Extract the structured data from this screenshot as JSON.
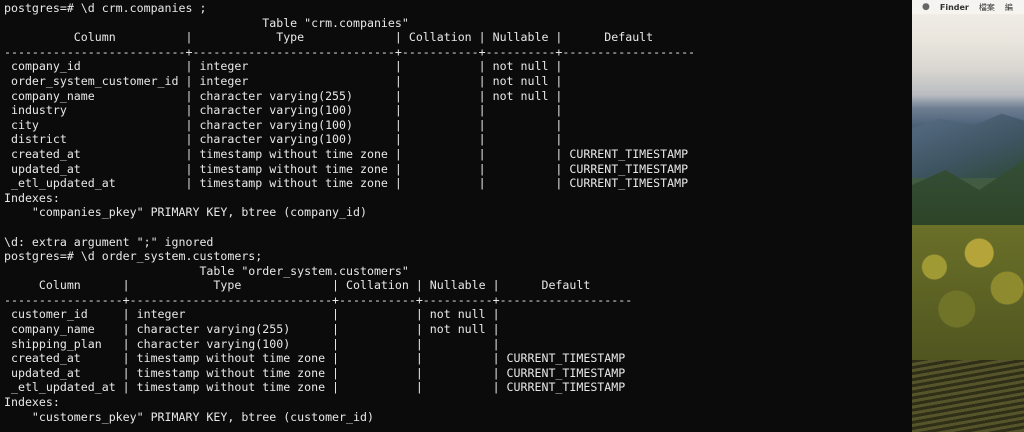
{
  "terminal": {
    "lines": [
      "postgres=# \\d crm.companies ;",
      "                                     Table \"crm.companies\"",
      "          Column          |            Type             | Collation | Nullable |      Default",
      "--------------------------+-----------------------------+-----------+----------+-------------------",
      " company_id               | integer                     |           | not null |",
      " order_system_customer_id | integer                     |           | not null |",
      " company_name             | character varying(255)      |           | not null |",
      " industry                 | character varying(100)      |           |          |",
      " city                     | character varying(100)      |           |          |",
      " district                 | character varying(100)      |           |          |",
      " created_at               | timestamp without time zone |           |          | CURRENT_TIMESTAMP",
      " updated_at               | timestamp without time zone |           |          | CURRENT_TIMESTAMP",
      " _etl_updated_at          | timestamp without time zone |           |          | CURRENT_TIMESTAMP",
      "Indexes:",
      "    \"companies_pkey\" PRIMARY KEY, btree (company_id)",
      "",
      "\\d: extra argument \";\" ignored",
      "postgres=# \\d order_system.customers;",
      "                            Table \"order_system.customers\"",
      "     Column      |            Type             | Collation | Nullable |      Default",
      "-----------------+-----------------------------+-----------+----------+-------------------",
      " customer_id     | integer                     |           | not null |",
      " company_name    | character varying(255)      |           | not null |",
      " shipping_plan   | character varying(100)      |           |          |",
      " created_at      | timestamp without time zone |           |          | CURRENT_TIMESTAMP",
      " updated_at      | timestamp without time zone |           |          | CURRENT_TIMESTAMP",
      " _etl_updated_at | timestamp without time zone |           |          | CURRENT_TIMESTAMP",
      "Indexes:",
      "    \"customers_pkey\" PRIMARY KEY, btree (customer_id)"
    ]
  },
  "menubar": {
    "icon": "apple-icon",
    "items": [
      "Finder",
      "檔案",
      "編"
    ]
  },
  "colors": {
    "terminal_bg": "#0b0b0b",
    "terminal_text": "#e8e8e8"
  }
}
